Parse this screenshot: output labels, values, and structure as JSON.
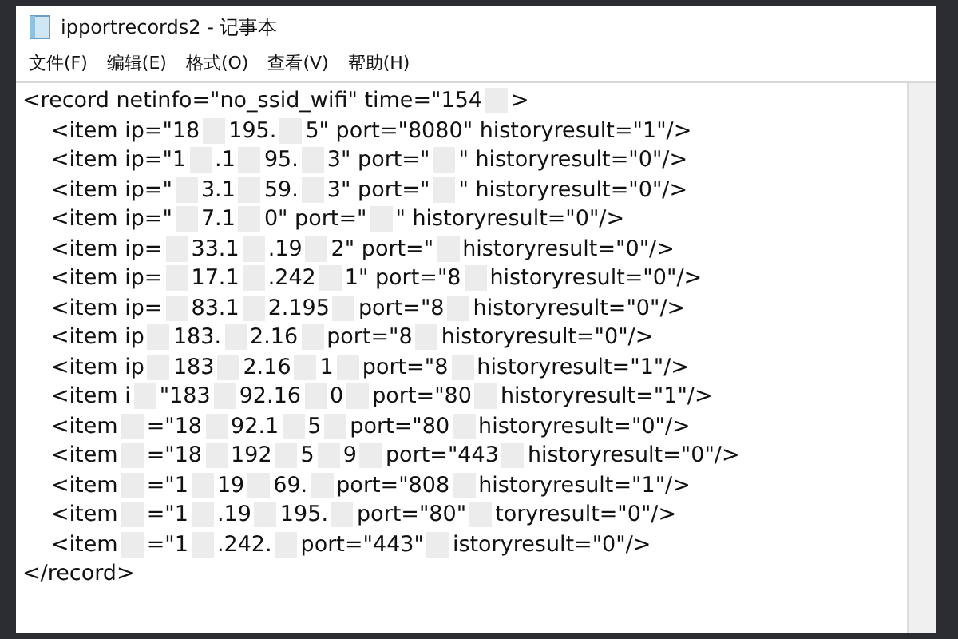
{
  "window": {
    "title": "ipportrecords2 - 记事本"
  },
  "menu": [
    {
      "label": "文件(F)"
    },
    {
      "label": "编辑(E)"
    },
    {
      "label": "格式(O)"
    },
    {
      "label": "查看(V)"
    },
    {
      "label": "帮助(H)"
    }
  ],
  "editor": {
    "lines": [
      {
        "parts": [
          "<record netinfo=\"no_ssid_wifi\" time=\"154",
          ">"
        ]
      },
      {
        "parts": [
          "<item ip=\"18",
          "195.",
          "5\" port=\"8080\" historyresult=\"1\"/>"
        ]
      },
      {
        "parts": [
          "<item ip=\"1",
          ".1",
          "95.",
          "3\" port=\"",
          "\" historyresult=\"0\"/>"
        ]
      },
      {
        "parts": [
          "<item ip=\"",
          "3.1",
          "59.",
          "3\" port=\"",
          "\" historyresult=\"0\"/>"
        ]
      },
      {
        "parts": [
          "<item ip=\"",
          "7.1",
          "0\" port=\"",
          "\" historyresult=\"0\"/>"
        ]
      },
      {
        "parts": [
          "<item ip=",
          "33.1",
          ".19",
          "2\" port=\"",
          "historyresult=\"0\"/>"
        ]
      },
      {
        "parts": [
          "<item ip=",
          "17.1",
          ".242",
          "1\" port=\"8",
          "historyresult=\"0\"/>"
        ]
      },
      {
        "parts": [
          "<item ip=",
          "83.1",
          "2.195",
          "port=\"8",
          "historyresult=\"0\"/>"
        ]
      },
      {
        "parts": [
          "<item ip",
          "183.",
          "2.16",
          "port=\"8",
          "historyresult=\"0\"/>"
        ]
      },
      {
        "parts": [
          "<item ip",
          "183",
          "2.16",
          "1",
          "port=\"8",
          "historyresult=\"1\"/>"
        ]
      },
      {
        "parts": [
          "<item i",
          "\"183",
          "92.16",
          "0",
          "port=\"80",
          "historyresult=\"1\"/>"
        ]
      },
      {
        "parts": [
          "<item",
          "=\"18",
          "92.1",
          "5",
          "port=\"80",
          "historyresult=\"0\"/>"
        ]
      },
      {
        "parts": [
          "<item",
          "=\"18",
          "192",
          "5",
          "9",
          "port=\"443",
          "historyresult=\"0\"/>"
        ]
      },
      {
        "parts": [
          "<item",
          "=\"1",
          "19",
          "69.",
          "port=\"808",
          "historyresult=\"1\"/>"
        ]
      },
      {
        "parts": [
          "<item",
          "=\"1",
          ".19",
          "195.",
          "port=\"80\"",
          "toryresult=\"0\"/>"
        ]
      },
      {
        "parts": [
          "<item",
          "=\"1",
          ".242.",
          "port=\"443\"",
          "istoryresult=\"0\"/>"
        ]
      },
      {
        "parts": [
          "</record>"
        ]
      }
    ]
  }
}
